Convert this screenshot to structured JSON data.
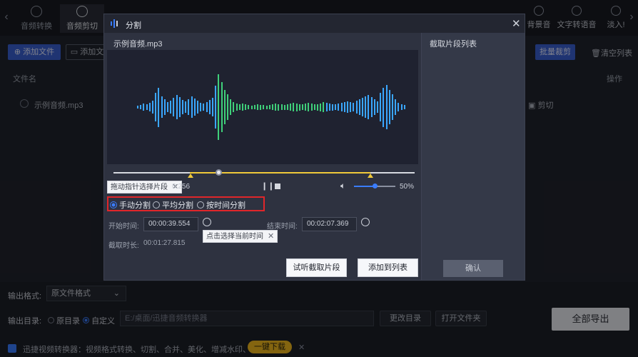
{
  "topbar": {
    "tools": [
      {
        "label": "音频转换",
        "active": false
      },
      {
        "label": "音频剪切",
        "active": true
      }
    ],
    "right_tools": [
      {
        "label": "背景音"
      },
      {
        "label": "文字转语音"
      },
      {
        "label": "淡入!"
      }
    ]
  },
  "actionbar": {
    "add_file": "添加文件",
    "add_folder": "添加文",
    "batch_cut": "批量裁剪",
    "clear_list": "清空列表"
  },
  "list": {
    "col_filename": "文件名",
    "col_action": "操作",
    "file_name": "示例音频.mp3",
    "row_action": "剪切"
  },
  "bottom": {
    "format_label": "输出格式:",
    "format_value": "原文件格式",
    "dir_label": "输出目录:",
    "dir_option_source": "原目录",
    "dir_option_custom": "自定义",
    "dir_path": "E:/桌面/迅捷音频转换器",
    "change_dir": "更改目录",
    "open_folder": "打开文件夹",
    "export_all": "全部导出",
    "promo_text": "迅捷视频转换器：视频格式转换、切割、合并、美化、增减水印、配乐",
    "promo_button": "一键下载"
  },
  "dialog": {
    "title": "分割",
    "file_name": "示例音频.mp3",
    "clip_list_title": "截取片段列表",
    "drag_tip": "拖动指针选择片段",
    "time_partial": "0.256",
    "volume": "50%",
    "modes": [
      {
        "label": "手动分割",
        "selected": true
      },
      {
        "label": "平均分割",
        "selected": false
      },
      {
        "label": "按时间分割",
        "selected": false
      }
    ],
    "start_label": "开始时间:",
    "start_value": "00:00:39.554",
    "end_label": "结束时间:",
    "end_value": "00:02:07.369",
    "current_time_tip": "点击选择当前时间",
    "duration_label": "截取时长:",
    "duration_value": "00:01:27.815",
    "preview_button": "试听截取片段",
    "add_to_list_button": "添加到列表",
    "confirm_button": "确认",
    "highlight_color": "#e0262a",
    "accent_color": "#3a7dff"
  }
}
